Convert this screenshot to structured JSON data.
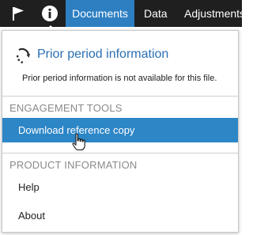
{
  "topbar": {
    "icons": [
      "flag-icon",
      "info-icon"
    ],
    "tabs": [
      {
        "label": "Documents",
        "active": true
      },
      {
        "label": "Data",
        "active": false
      },
      {
        "label": "Adjustments",
        "active": false
      }
    ]
  },
  "menu": {
    "prior_period": {
      "icon": "prior-period-icon",
      "title": "Prior period information",
      "description": "Prior period information is not available for this file."
    },
    "engagement_tools": {
      "header": "ENGAGEMENT TOOLS",
      "items": [
        {
          "label": "Download reference copy",
          "highlighted": true
        }
      ]
    },
    "product_information": {
      "header": "PRODUCT INFORMATION",
      "items": [
        {
          "label": "Help"
        },
        {
          "label": "About"
        }
      ]
    }
  },
  "colors": {
    "topbar_bg": "#1f1f1f",
    "active_tab": "#2d7fc2",
    "highlight": "#2d86c6",
    "title_blue": "#2b6fb3",
    "section_gray": "#8a8a8a"
  }
}
